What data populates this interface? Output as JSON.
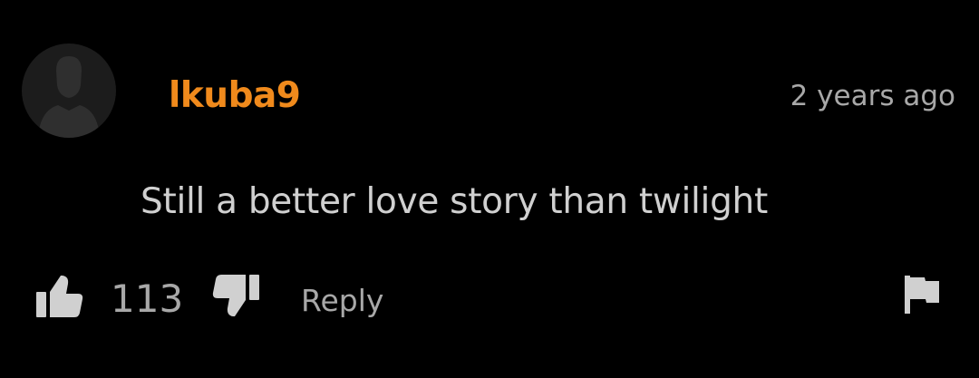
{
  "colors": {
    "background": "#000000",
    "username": "#f08a1c",
    "text": "#d0d0d0",
    "muted": "#a8a8a8",
    "icon": "#d0d0d0",
    "avatar_bg": "#1c1c1c",
    "avatar_silhouette": "#2f2f2f"
  },
  "comment": {
    "avatar_icon": "default-user-avatar-icon",
    "username": "lkuba9",
    "timestamp": "2 years ago",
    "text": "Still a better love story than twilight"
  },
  "actions": {
    "like_icon": "thumbs-up-icon",
    "like_count": "113",
    "dislike_icon": "thumbs-down-icon",
    "reply_label": "Reply",
    "flag_icon": "flag-icon"
  }
}
